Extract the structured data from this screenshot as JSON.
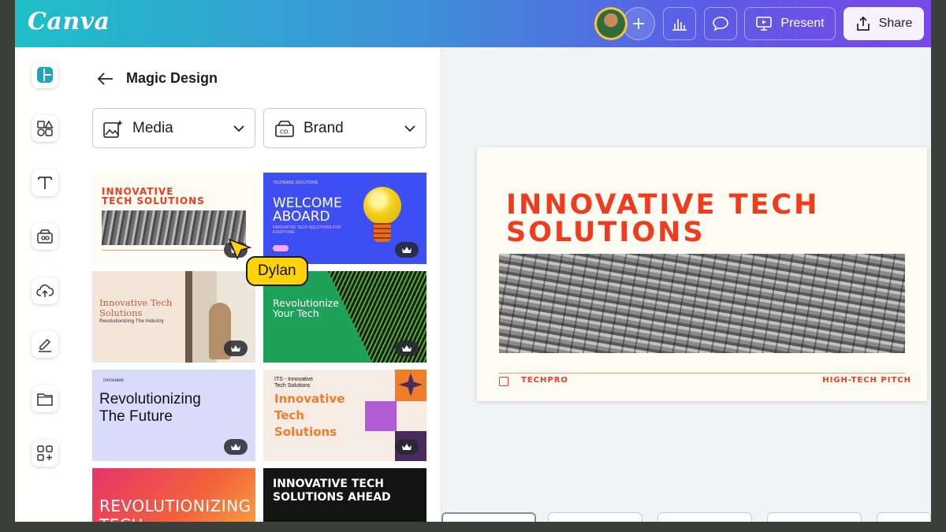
{
  "app": {
    "logo": "Canva"
  },
  "topbar": {
    "present_label": "Present",
    "share_label": "Share"
  },
  "panel": {
    "title": "Magic Design",
    "media_label": "Media",
    "brand_label": "Brand"
  },
  "templates": [
    {
      "title_l1": "INNOVATIVE",
      "title_l2": "TECH SOLUTIONS"
    },
    {
      "small": "TECHEASE SOLUTIONS",
      "title_l1": "WELCOME",
      "title_l2": "ABOARD",
      "sub": "INNOVATIVE TECH SOLUTIONS FOR EVERYONE"
    },
    {
      "title_l1": "Innovative Tech",
      "title_l2": "Solutions",
      "sub": "Revolutionizing The Industry"
    },
    {
      "title_l1": "Revolutionize",
      "title_l2": "Your Tech"
    },
    {
      "small": "Innovatek",
      "title_l1": "Revolutionizing",
      "title_l2": "The Future"
    },
    {
      "small_l1": "ITS - Innovative",
      "small_l2": "Tech Solutions",
      "title_l1": "Innovative",
      "title_l2": "Tech",
      "title_l3": "Solutions"
    },
    {
      "title_l1": "REVOLUTIONIZING",
      "title_l2": "TECH"
    },
    {
      "title_l1": "INNOVATIVE TECH",
      "title_l2": "SOLUTIONS AHEAD"
    }
  ],
  "collaborator": {
    "name": "Dylan"
  },
  "slide": {
    "title_l1": "INNOVATIVE TECH",
    "title_l2": "SOLUTIONS",
    "brand": "TECHPRO",
    "tagline": "HIGH-TECH PITCH"
  },
  "colors": {
    "accent_red": "#f03b1e",
    "cursor_yellow": "#ffd20a"
  },
  "icons": [
    "design-icon",
    "elements-icon",
    "text-icon",
    "brand-icon",
    "uploads-icon",
    "draw-icon",
    "projects-icon",
    "apps-icon"
  ]
}
